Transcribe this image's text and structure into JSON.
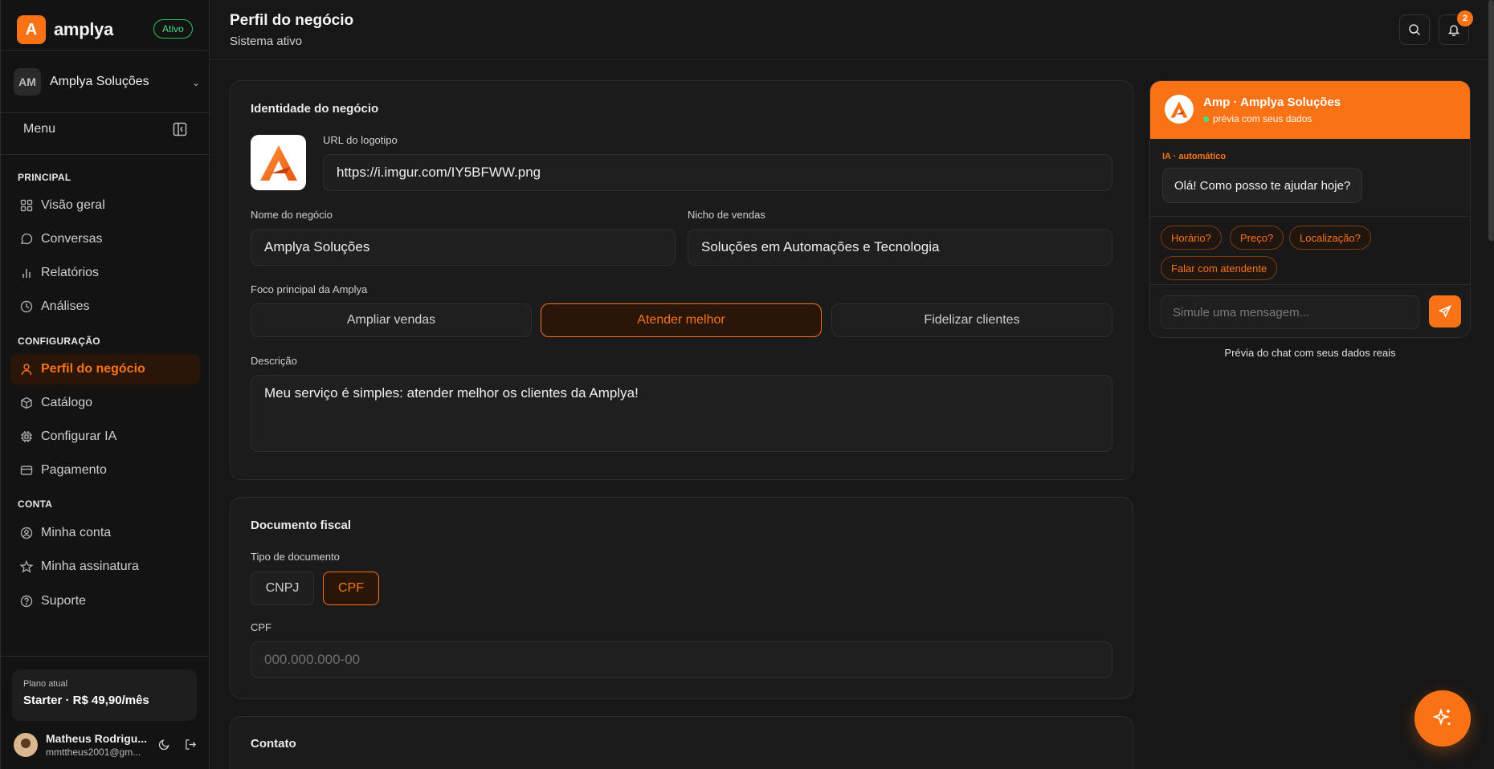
{
  "sidebar": {
    "brand_letter": "A",
    "brand_name": "amplya",
    "status_badge": "Ativo",
    "org_initials": "AM",
    "org_name": "Amplya Soluções",
    "menu_label": "Menu",
    "sections": {
      "principal": "PRINCIPAL",
      "configuracao": "CONFIGURAÇÃO",
      "conta": "CONTA"
    },
    "items": [
      {
        "label": "Visão geral",
        "icon": "grid-icon"
      },
      {
        "label": "Conversas",
        "icon": "chat-bubble-icon"
      },
      {
        "label": "Relatórios",
        "icon": "bar-chart-icon"
      },
      {
        "label": "Análises",
        "icon": "clock-icon"
      },
      {
        "label": "Perfil do negócio",
        "icon": "user-icon",
        "active": true
      },
      {
        "label": "Catálogo",
        "icon": "box-icon"
      },
      {
        "label": "Configurar IA",
        "icon": "cpu-icon"
      },
      {
        "label": "Pagamento",
        "icon": "credit-card-icon"
      },
      {
        "label": "Minha conta",
        "icon": "user-circle-icon"
      },
      {
        "label": "Minha assinatura",
        "icon": "star-icon"
      },
      {
        "label": "Suporte",
        "icon": "help-circle-icon"
      }
    ],
    "plan": {
      "label": "Plano atual",
      "value": "Starter · R$ 49,90/mês"
    },
    "user": {
      "name": "Matheus Rodrigu...",
      "email": "mmttheus2001@gm..."
    }
  },
  "header": {
    "title": "Perfil do negócio",
    "subtitle": "Sistema ativo",
    "notifications_count": "2"
  },
  "identity": {
    "title": "Identidade do negócio",
    "logo_url_label": "URL do logotipo",
    "logo_url_value": "https://i.imgur.com/IY5BFWW.png",
    "business_name_label": "Nome do negócio",
    "business_name_value": "Amplya Soluções",
    "niche_label": "Nicho de vendas",
    "niche_value": "Soluções em Automações e Tecnologia",
    "focus_label": "Foco principal da Amplya",
    "focus_options": [
      "Ampliar vendas",
      "Atender melhor",
      "Fidelizar clientes"
    ],
    "focus_selected": "Atender melhor",
    "description_label": "Descrição",
    "description_value": "Meu serviço é simples: atender melhor os clientes da Amplya!"
  },
  "fiscal": {
    "title": "Documento fiscal",
    "doc_type_label": "Tipo de documento",
    "doc_types": [
      "CNPJ",
      "CPF"
    ],
    "doc_type_selected": "CPF",
    "cpf_label": "CPF",
    "cpf_placeholder": "000.000.000-00"
  },
  "contact": {
    "title": "Contato"
  },
  "chat_preview": {
    "name": "Amp · Amplya Soluções",
    "status": "prévia com seus dados",
    "ia_label": "IA · automático",
    "greeting": "Olá! Como posso te ajudar hoje?",
    "quick_replies": [
      "Horário?",
      "Preço?",
      "Localização?",
      "Falar com atendente"
    ],
    "input_placeholder": "Simule uma mensagem...",
    "caption": "Prévia do chat com seus dados reais"
  },
  "colors": {
    "accent": "#f97316",
    "background": "#171717",
    "success": "#22c55e"
  }
}
